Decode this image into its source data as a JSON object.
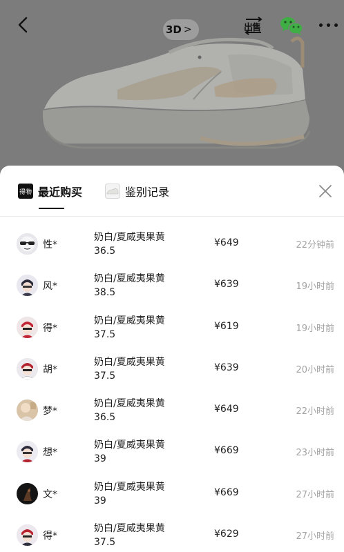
{
  "header": {
    "badge_3d": "3D",
    "badge_chevron": ">",
    "sell_label": "出售"
  },
  "colors": {
    "backdrop": "#7c7c7c",
    "sheet": "#ffffff",
    "text_primary": "#222222",
    "text_muted": "#a3a3a3",
    "wechat_green": "#3fae45"
  },
  "sheet": {
    "tabs": [
      {
        "label": "最近购买",
        "icon": "dewu-logo-icon",
        "active": true
      },
      {
        "label": "鉴别记录",
        "icon": "sneaker-thumbnail-icon",
        "active": false
      }
    ],
    "close_icon": "close-icon"
  },
  "purchases": [
    {
      "name": "性*",
      "color": "奶白/夏威夷果黄",
      "size": "36.5",
      "price": "¥649",
      "time": "22分钟前",
      "avatar": "sunglasses-avatar"
    },
    {
      "name": "风*",
      "color": "奶白/夏威夷果黄",
      "size": "38.5",
      "price": "¥639",
      "time": "19小时前",
      "avatar": "cartoon-avatar"
    },
    {
      "name": "得*",
      "color": "奶白/夏威夷果黄",
      "size": "37.5",
      "price": "¥619",
      "time": "19小时前",
      "avatar": "cartoon-avatar"
    },
    {
      "name": "胡*",
      "color": "奶白/夏威夷果黄",
      "size": "37.5",
      "price": "¥639",
      "time": "20小时前",
      "avatar": "cartoon-avatar"
    },
    {
      "name": "梦*",
      "color": "奶白/夏威夷果黄",
      "size": "36.5",
      "price": "¥649",
      "time": "22小时前",
      "avatar": "photo-avatar"
    },
    {
      "name": "想*",
      "color": "奶白/夏威夷果黄",
      "size": "39",
      "price": "¥669",
      "time": "23小时前",
      "avatar": "cartoon-avatar"
    },
    {
      "name": "文*",
      "color": "奶白/夏威夷果黄",
      "size": "39",
      "price": "¥669",
      "time": "27小时前",
      "avatar": "dark-photo-avatar"
    },
    {
      "name": "得*",
      "color": "奶白/夏威夷果黄",
      "size": "37.5",
      "price": "¥629",
      "time": "27小时前",
      "avatar": "cartoon-avatar"
    }
  ]
}
